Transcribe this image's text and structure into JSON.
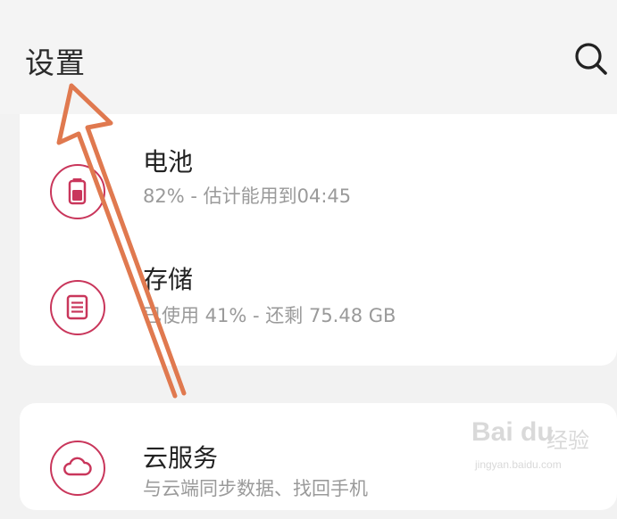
{
  "header": {
    "title": "设置",
    "search_icon": "search-icon"
  },
  "device_card": {
    "items": [
      {
        "icon": "battery-icon",
        "title": "电池",
        "subtitle": "82% - 估计能用到04:45"
      },
      {
        "icon": "storage-icon",
        "title": "存储",
        "subtitle": "已使用 41% - 还剩 75.48 GB"
      }
    ]
  },
  "account_card": {
    "items": [
      {
        "icon": "cloud-icon",
        "title": "云服务",
        "subtitle": "与云端同步数据、找回手机"
      }
    ]
  },
  "watermark": {
    "main": "Bai du",
    "cn": "经验",
    "url": "jingyan.baidu.com"
  },
  "colors": {
    "accent": "#c9365b",
    "annotation_arrow": "#e0794f",
    "background": "#f2f2f2"
  }
}
